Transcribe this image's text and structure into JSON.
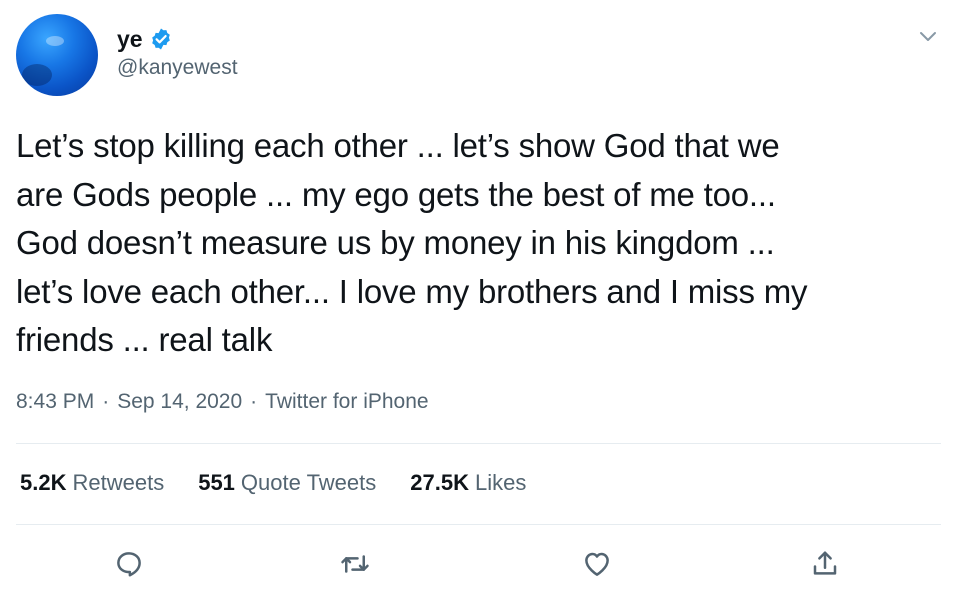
{
  "author": {
    "display_name": "ye",
    "handle": "@kanyewest",
    "verified": true,
    "avatar_icon": "blue-globe-avatar",
    "verified_color": "#1d9bf0"
  },
  "tweet": {
    "text": "Let’s stop killing each other ... let’s show God that we\nare Gods people ... my ego gets the best of me too...\nGod doesn’t measure us by money in his kingdom ...\nlet’s love each other... I love my brothers and I miss my\nfriends ... real talk",
    "time": "8:43 PM",
    "date": "Sep 14, 2020",
    "source": "Twitter for iPhone",
    "separator": "·"
  },
  "stats": {
    "retweets_count": "5.2K",
    "retweets_label": "Retweets",
    "quotes_count": "551",
    "quotes_label": "Quote Tweets",
    "likes_count": "27.5K",
    "likes_label": "Likes"
  },
  "actions": {
    "reply_icon": "reply-icon",
    "retweet_icon": "retweet-icon",
    "like_icon": "heart-icon",
    "share_icon": "share-icon",
    "more_icon": "chevron-down-icon"
  },
  "colors": {
    "text_primary": "#0f1419",
    "text_secondary": "#536471",
    "divider": "#e6ecf0"
  }
}
